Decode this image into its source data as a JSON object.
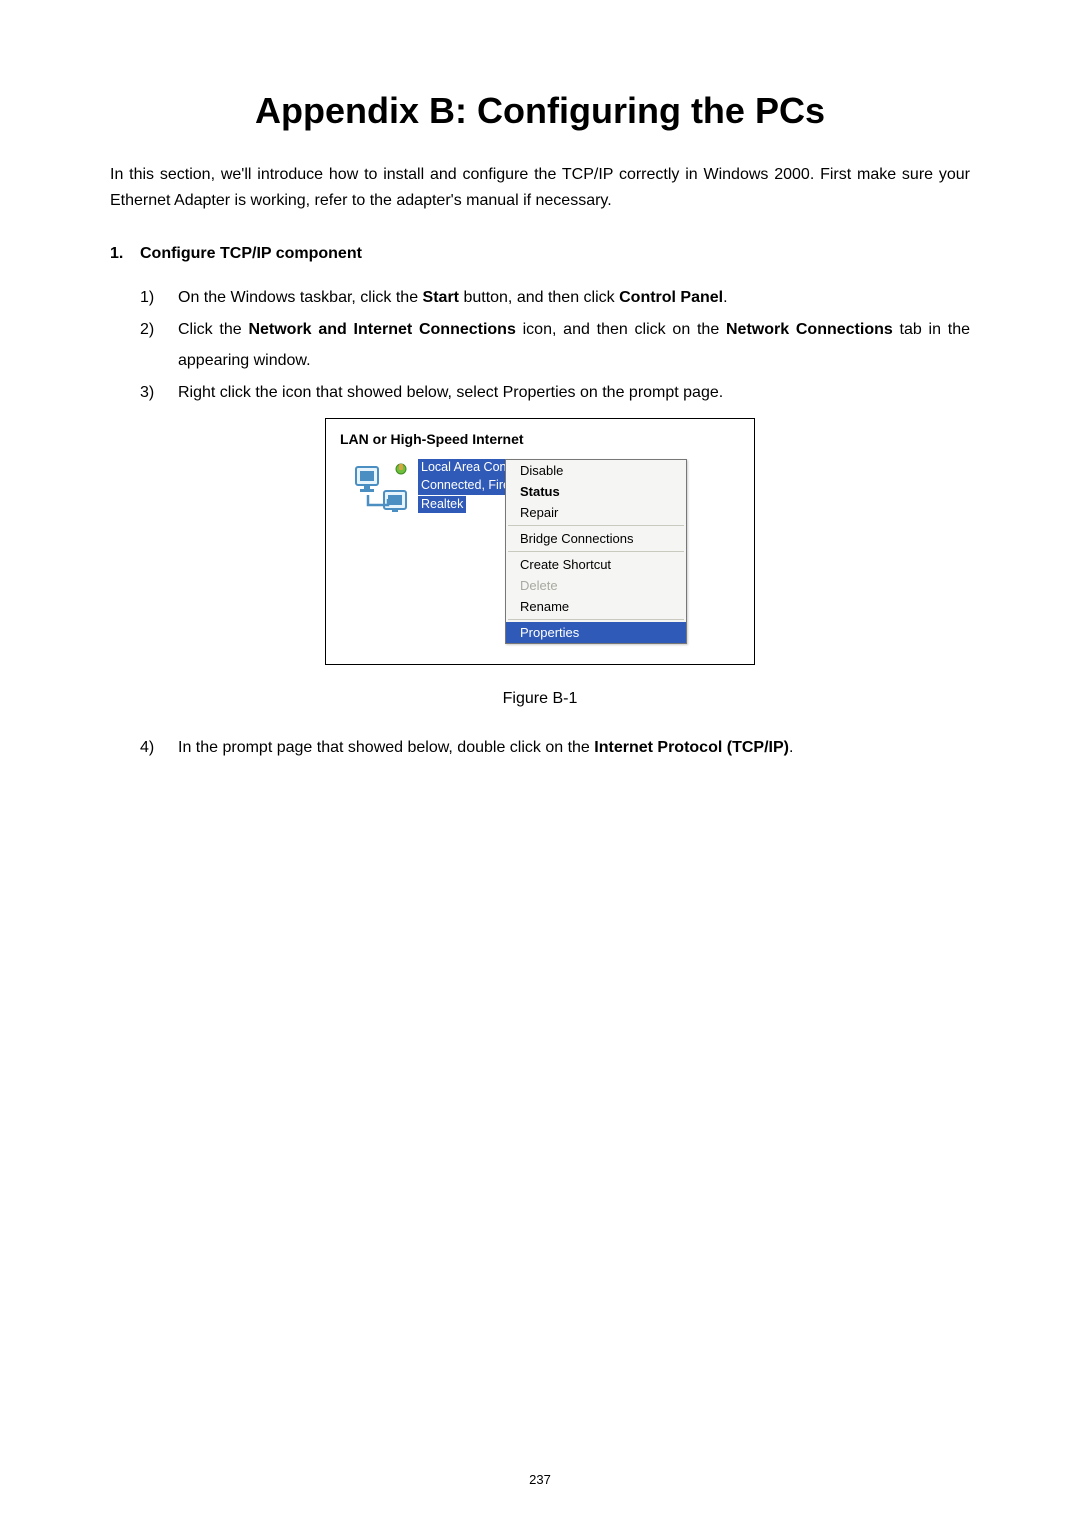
{
  "title": "Appendix B: Configuring the PCs",
  "intro": "In this section, we'll introduce how to install and configure the TCP/IP correctly in Windows 2000. First make sure your Ethernet Adapter is working, refer to the adapter's manual if necessary.",
  "section": {
    "number": "1.",
    "heading": "Configure TCP/IP component"
  },
  "steps": {
    "s1_num": "1)",
    "s1_a": "On the Windows taskbar, click the ",
    "s1_b": "Start",
    "s1_c": " button, and then click ",
    "s1_d": "Control Panel",
    "s1_e": ".",
    "s2_num": "2)",
    "s2_a": "Click the ",
    "s2_b": "Network and Internet Connections",
    "s2_c": " icon, and then click on the ",
    "s2_d": "Network Connections",
    "s2_e": " tab in the appearing window.",
    "s3_num": "3)",
    "s3_a": "Right click the icon that showed below, select Properties on the prompt page.",
    "s4_num": "4)",
    "s4_a": "In the prompt page that showed below, double click on the ",
    "s4_b": "Internet Protocol (TCP/IP)",
    "s4_c": "."
  },
  "figure": {
    "group_title": "LAN or High-Speed Internet",
    "conn_l1": "Local Area Connection",
    "conn_l2": "Connected, Firewalled",
    "conn_l3": "Realtek",
    "menu": {
      "disable": "Disable",
      "status": "Status",
      "repair": "Repair",
      "bridge": "Bridge Connections",
      "shortcut": "Create Shortcut",
      "delete": "Delete",
      "rename": "Rename",
      "properties": "Properties"
    },
    "caption": "Figure B-1"
  },
  "page_number": "237"
}
